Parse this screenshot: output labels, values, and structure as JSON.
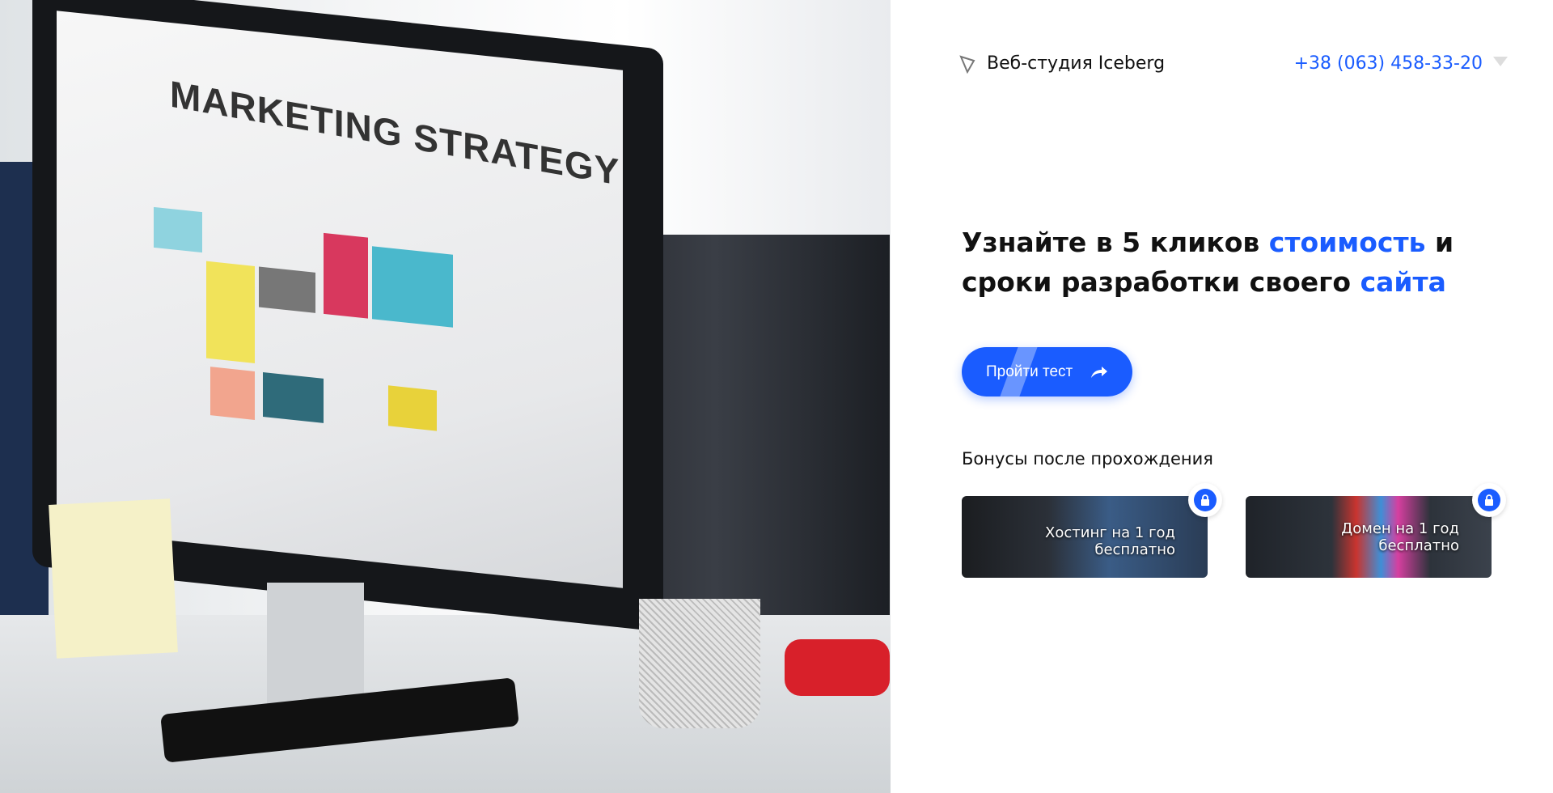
{
  "header": {
    "logo_text": "Веб-студия Iceberg",
    "phone": "+38 (063) 458-33-20"
  },
  "hero_image": {
    "screen_text": "MARKETING STRATEGY"
  },
  "main": {
    "headline_part1": "Узнайте в 5 кликов ",
    "headline_hl1": "стоимость",
    "headline_part2": " и сроки разработки своего ",
    "headline_hl2": "сайта",
    "cta_label": "Пройти тест",
    "bonuses_title": "Бонусы после прохождения",
    "bonuses": [
      {
        "line1": "Хостинг на 1 год",
        "line2": "бесплатно"
      },
      {
        "line1": "Домен на 1 год",
        "line2": "бесплатно"
      }
    ]
  },
  "colors": {
    "accent": "#1a5cff"
  }
}
